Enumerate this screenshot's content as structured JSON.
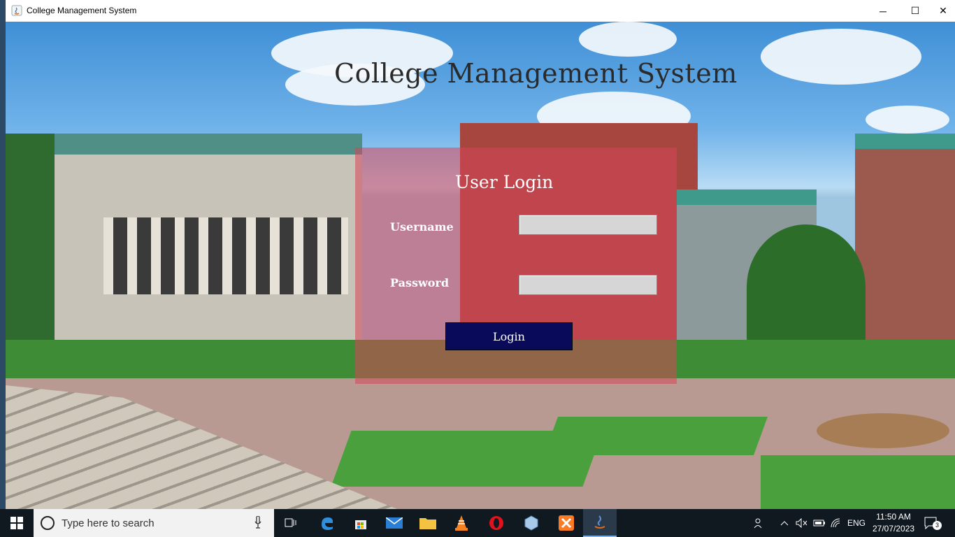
{
  "window": {
    "title": "College Management System",
    "app_icon": "java-icon",
    "controls": {
      "minimize": "─",
      "maximize": "☐",
      "close": "✕"
    }
  },
  "app": {
    "heading": "College Management System"
  },
  "login": {
    "title": "User Login",
    "username_label": "Username",
    "username_value": "",
    "password_label": "Password",
    "password_value": "",
    "login_button": "Login"
  },
  "taskbar": {
    "search_placeholder": "Type here to search",
    "pinned": [
      "task-view-icon",
      "edge-icon",
      "store-icon",
      "mail-icon",
      "file-explorer-icon",
      "vlc-icon",
      "opera-icon",
      "virtualbox-icon",
      "xampp-icon",
      "java-icon"
    ],
    "tray": {
      "language": "ENG",
      "time": "11:50 AM",
      "date": "27/07/2023",
      "notifications": "3"
    }
  }
}
